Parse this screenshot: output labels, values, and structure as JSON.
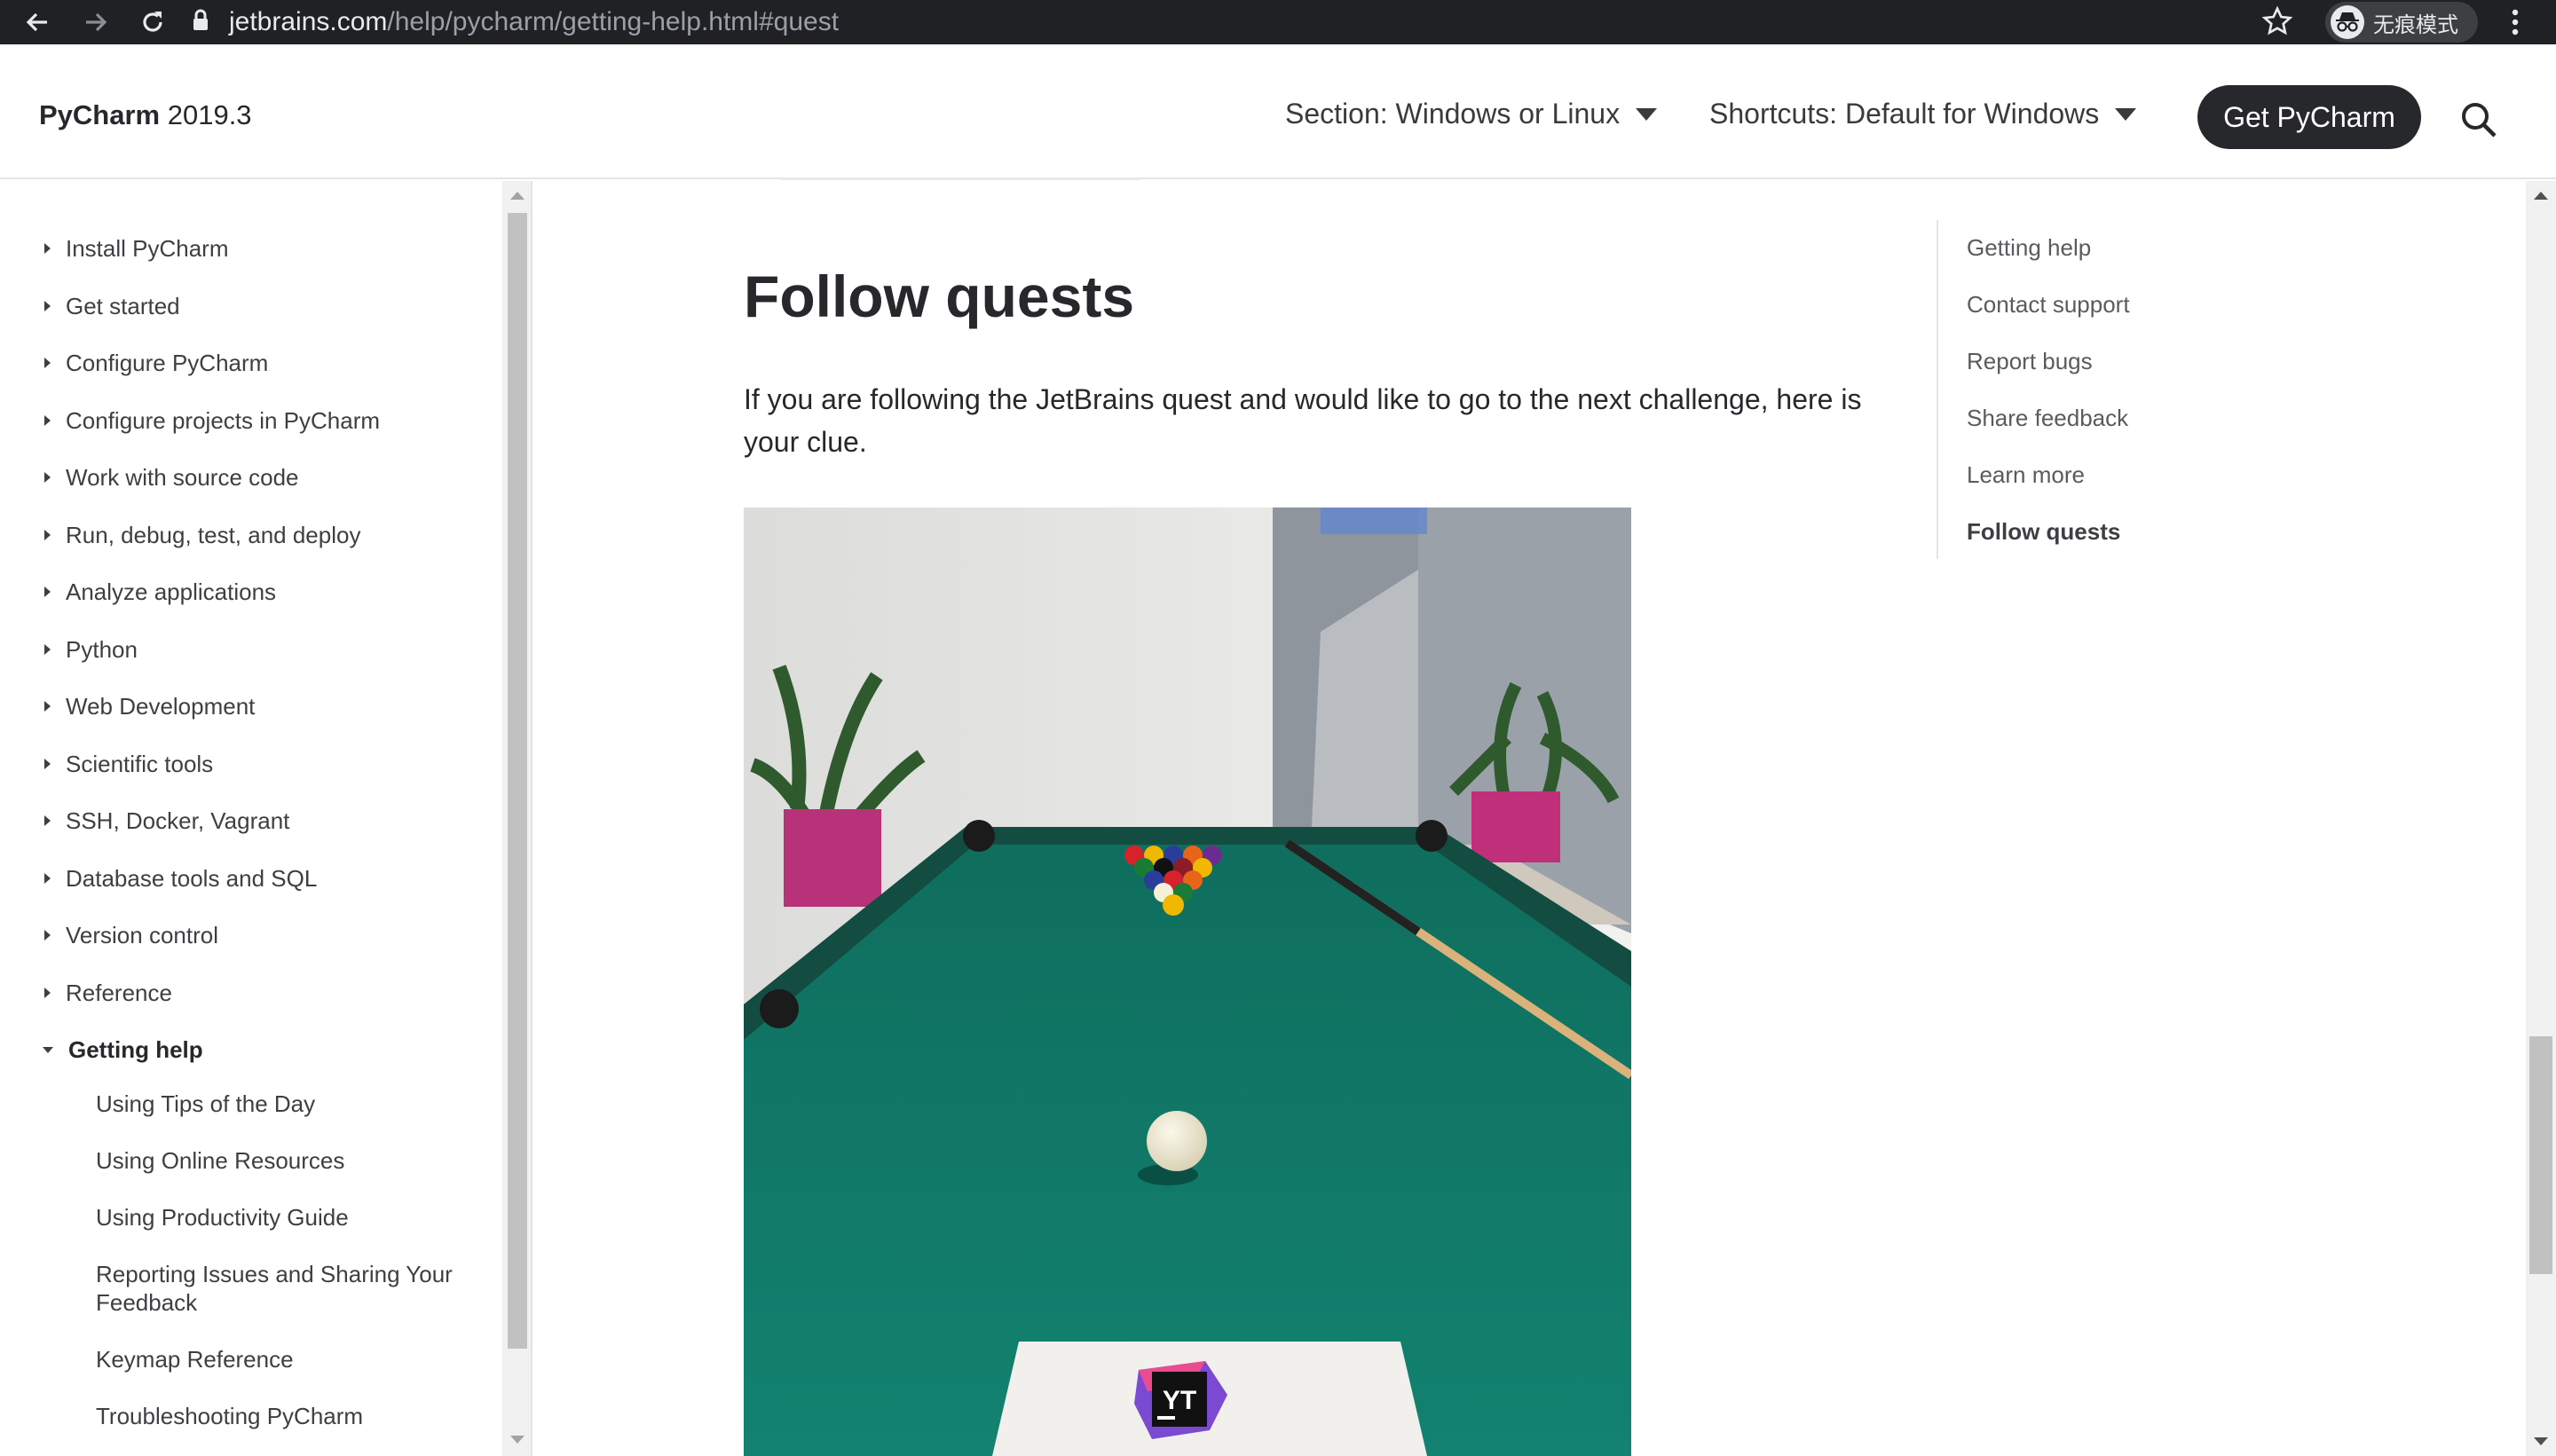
{
  "browser": {
    "url_host": "jetbrains.com",
    "url_path": "/help/pycharm/getting-help.html#quest",
    "incognito_label": "无痕模式",
    "icons": [
      "back-arrow-icon",
      "forward-arrow-icon",
      "reload-icon",
      "lock-icon",
      "star-icon",
      "incognito-icon",
      "kebab-menu-icon"
    ]
  },
  "header": {
    "product_name": "PyCharm",
    "product_version": "2019.3",
    "section_label": "Section: Windows or Linux",
    "shortcuts_label": "Shortcuts: Default for Windows",
    "cta_label": "Get PyCharm",
    "accent": "#27282c"
  },
  "sidebar": {
    "items": [
      {
        "label": "Install PyCharm"
      },
      {
        "label": "Get started"
      },
      {
        "label": "Configure PyCharm"
      },
      {
        "label": "Configure projects in PyCharm"
      },
      {
        "label": "Work with source code"
      },
      {
        "label": "Run, debug, test, and deploy"
      },
      {
        "label": "Analyze applications"
      },
      {
        "label": "Python"
      },
      {
        "label": "Web Development"
      },
      {
        "label": "Scientific tools"
      },
      {
        "label": "SSH, Docker, Vagrant"
      },
      {
        "label": "Database tools and SQL"
      },
      {
        "label": "Version control"
      },
      {
        "label": "Reference"
      },
      {
        "label": "Getting help"
      }
    ],
    "subitems": [
      {
        "label": "Using Tips of the Day"
      },
      {
        "label": "Using Online Resources"
      },
      {
        "label": "Using Productivity Guide"
      },
      {
        "label": "Reporting Issues and Sharing Your Feedback"
      },
      {
        "label": "Keymap Reference"
      },
      {
        "label": "Troubleshooting PyCharm"
      }
    ]
  },
  "main": {
    "title": "Follow quests",
    "paragraph": "If you are following the JetBrains quest and would like to go to the next challenge, here is your clue.",
    "image_logo_text": "YT"
  },
  "right_toc": {
    "items": [
      {
        "label": "Getting help"
      },
      {
        "label": "Contact support"
      },
      {
        "label": "Report bugs"
      },
      {
        "label": "Share feedback"
      },
      {
        "label": "Learn more"
      },
      {
        "label": "Follow quests"
      }
    ]
  }
}
